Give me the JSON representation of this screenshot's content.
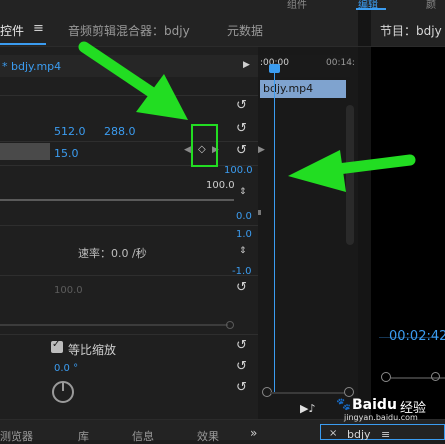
{
  "top_strip": {
    "left": "组件",
    "mid": "编辑",
    "right": "颜"
  },
  "tabs": {
    "effect_controls": "控件",
    "menu": "≡",
    "audio_mixer": "音频剪辑混合器：bdjy",
    "metadata": "元数据",
    "program": "节目：bdjy"
  },
  "clip_header": "* bdjy.mp4",
  "play_arrow": "▶",
  "ruler": {
    "t0": ":00:00",
    "t1": "00:14:"
  },
  "clip_bar": "bdjy.mp4",
  "position": {
    "x": "512.0",
    "y": "288.0"
  },
  "scale_value": "15.0",
  "graph": {
    "top_max": "100.0",
    "top_line": "100.0",
    "top_min": "0.0",
    "mid_max": "1.0",
    "mid_min": "-1.0"
  },
  "velocity": "速率：0.0 /秒",
  "dim_value": "100.0",
  "uniform_scale": {
    "label": "等比缩放",
    "checked": true
  },
  "rotation": "0.0 °",
  "program_timecode": "00:02:42",
  "bottom_tabs": [
    "测览器",
    "库",
    "信息",
    "效果",
    "»"
  ],
  "bottom_right": {
    "close": "×",
    "label": "bdjy",
    "menu": "≡"
  },
  "watermark": {
    "brand": "Baidu",
    "sub": "经验",
    "url": "jingyan.baidu.com"
  },
  "colors": {
    "accent": "#3b9cf0",
    "arrow": "#22dd22",
    "highlight_box": "#22dd22"
  }
}
